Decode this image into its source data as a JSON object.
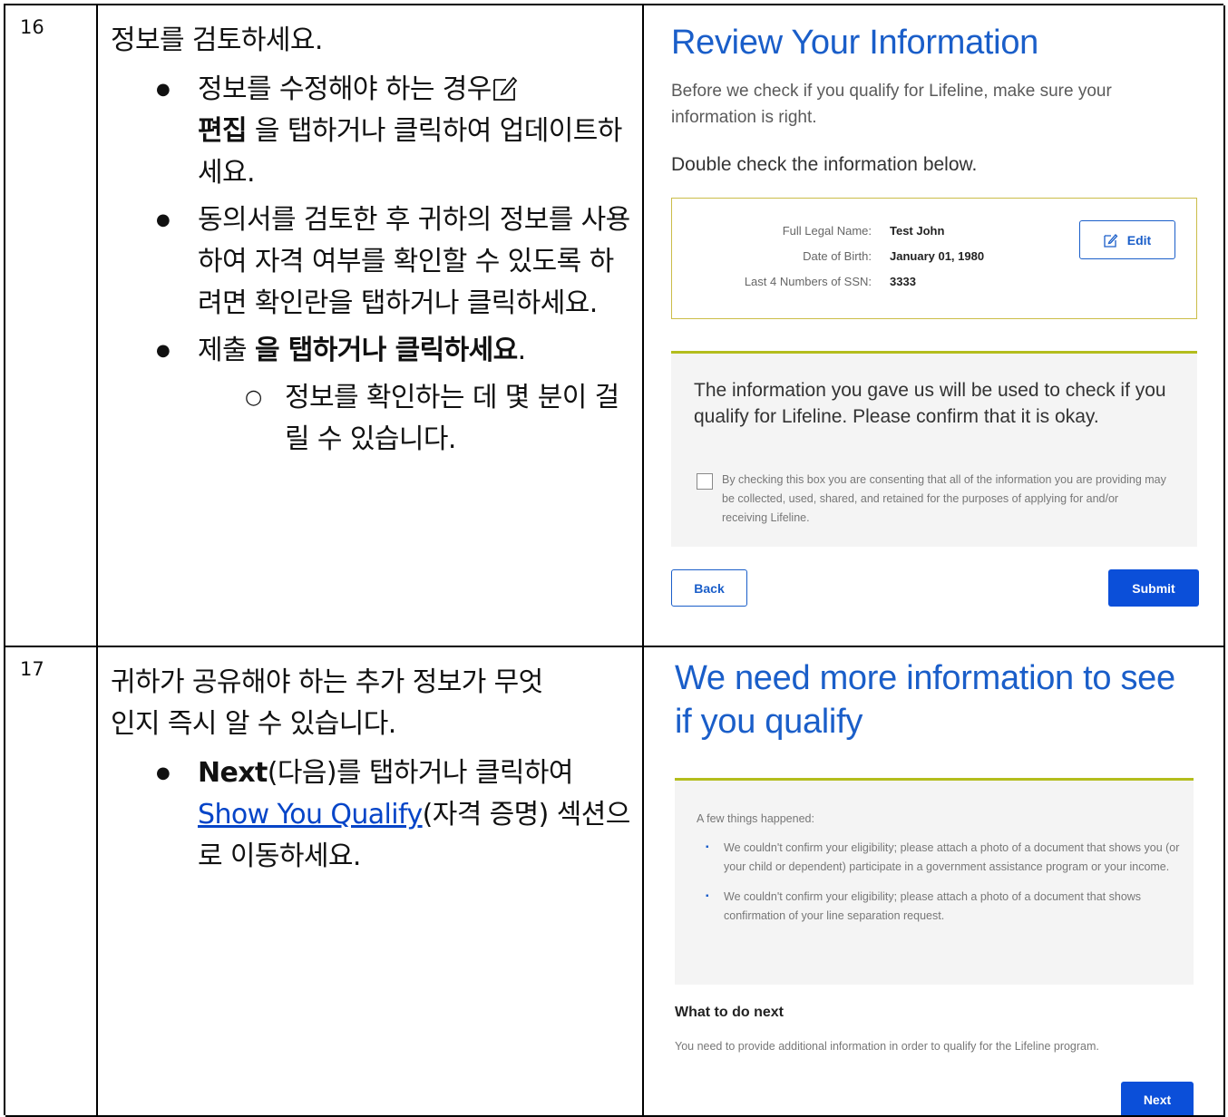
{
  "rows": [
    {
      "step": "16",
      "instructions": {
        "intro": "정보를 검토하세요.",
        "b1_pre": "정보를 수정해야 하는 경우",
        "b1_bold": "편집",
        "b1_post": " 을 탭하거나 클릭하여 업데이트하세요.",
        "b2": "동의서를 검토한 후 귀하의 정보를 사용하여 자격 여부를 확인할 수 있도록 하려면 확인란을 탭하거나 클릭하세요.",
        "b3_pre": "제출 ",
        "b3_bold": "을 탭하거나 클릭하세요",
        "b3_post": ".",
        "sub1": "정보를 확인하는 데 몇 분이 걸릴 수 있습니다."
      },
      "screen": {
        "title": "Review Your Information",
        "subtitle": "Before we check if you qualify for Lifeline, make sure your information is right.",
        "double_check": "Double check the information below.",
        "fields": [
          {
            "label": "Full Legal Name:",
            "value": "Test John"
          },
          {
            "label": "Date of Birth:",
            "value": "January 01, 1980"
          },
          {
            "label": "Last 4 Numbers of SSN:",
            "value": "3333"
          }
        ],
        "edit_label": "Edit",
        "consent_heading": "The information you gave us will be used to check if you qualify for Lifeline. Please confirm that it is okay.",
        "consent_text": "By checking this box you are consenting that all of the information you are providing may be collected, used, shared, and retained for the purposes of applying for and/or receiving Lifeline.",
        "back_label": "Back",
        "submit_label": "Submit"
      }
    },
    {
      "step": "17",
      "instructions": {
        "intro": "귀하가 공유해야 하는 추가 정보가 무엇인지 즉시 알 수 있습니다.",
        "b1_bold": "Next",
        "b1_mid": "(다음)를 탭하거나 클릭하여 ",
        "b1_link": "Show You Qualify",
        "b1_post": "(자격 증명) 섹션으로 이동하세요."
      },
      "screen": {
        "title": "We need more information to see if you qualify",
        "happened": "A few things happened:",
        "items": [
          "We couldn't confirm your eligibility; please attach a photo of a document that shows you (or your child or dependent) participate in a government assistance program or your income.",
          "We couldn't confirm your eligibility; please attach a photo of a document that shows confirmation of your line separation request."
        ],
        "next_heading": "What to do next",
        "next_text": "You need to provide additional information in order to qualify for the Lifeline program.",
        "next_label": "Next"
      }
    }
  ],
  "colors": {
    "accent": "#1a5ec9",
    "button": "#0b4fd9",
    "rule": "#b3bd1c"
  },
  "icons": [
    "edit-icon",
    "checkbox"
  ]
}
